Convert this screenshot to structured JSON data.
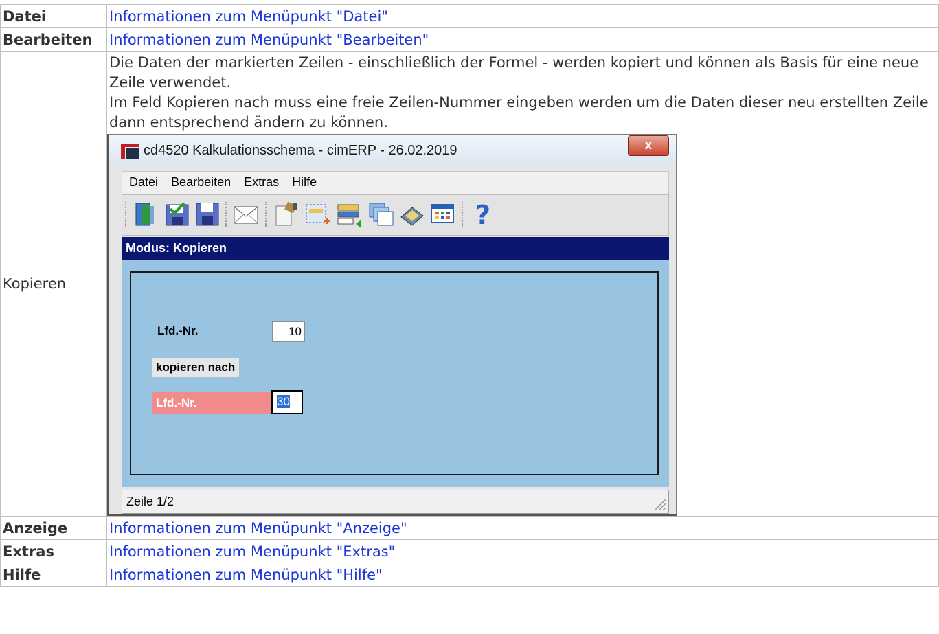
{
  "rows": {
    "datei": {
      "key": "Datei",
      "link": "Informationen zum Menüpunkt \"Datei\""
    },
    "bearbeiten": {
      "key": "Bearbeiten",
      "link": "Informationen zum Menüpunkt \"Bearbeiten\""
    },
    "kopieren": {
      "key": "Kopieren",
      "paragraphs": [
        "Die Daten der markierten Zeilen - einschließlich der Formel - werden kopiert und können als Basis für eine neue Zeile verwendet.",
        "Im Feld Kopieren nach muss eine freie Zeilen-Nummer eingeben werden um die Daten dieser neu erstellten Zeile dann entsprechend ändern zu können."
      ]
    },
    "anzeige": {
      "key": "Anzeige",
      "link": "Informationen zum Menüpunkt \"Anzeige\""
    },
    "extras": {
      "key": "Extras",
      "link": "Informationen zum Menüpunkt \"Extras\""
    },
    "hilfe": {
      "key": "Hilfe",
      "link": "Informationen zum Menüpunkt \"Hilfe\""
    }
  },
  "window": {
    "title": "cd4520 Kalkulationsschema - cimERP - 26.02.2019",
    "close": "x",
    "menu": [
      "Datei",
      "Bearbeiten",
      "Extras",
      "Hilfe"
    ],
    "modus": "Modus: Kopieren",
    "lfd_label": "Lfd.-Nr.",
    "lfd_value": "10",
    "kopieren_nach": "kopieren nach",
    "target_label": "Lfd.-Nr.",
    "target_value": "30",
    "status": "Zeile 1/2"
  },
  "colors": {
    "link": "#1c37d9",
    "modus_bar": "#0a1670",
    "panel": "#98c4e1",
    "target_label": "#f28b8b"
  }
}
